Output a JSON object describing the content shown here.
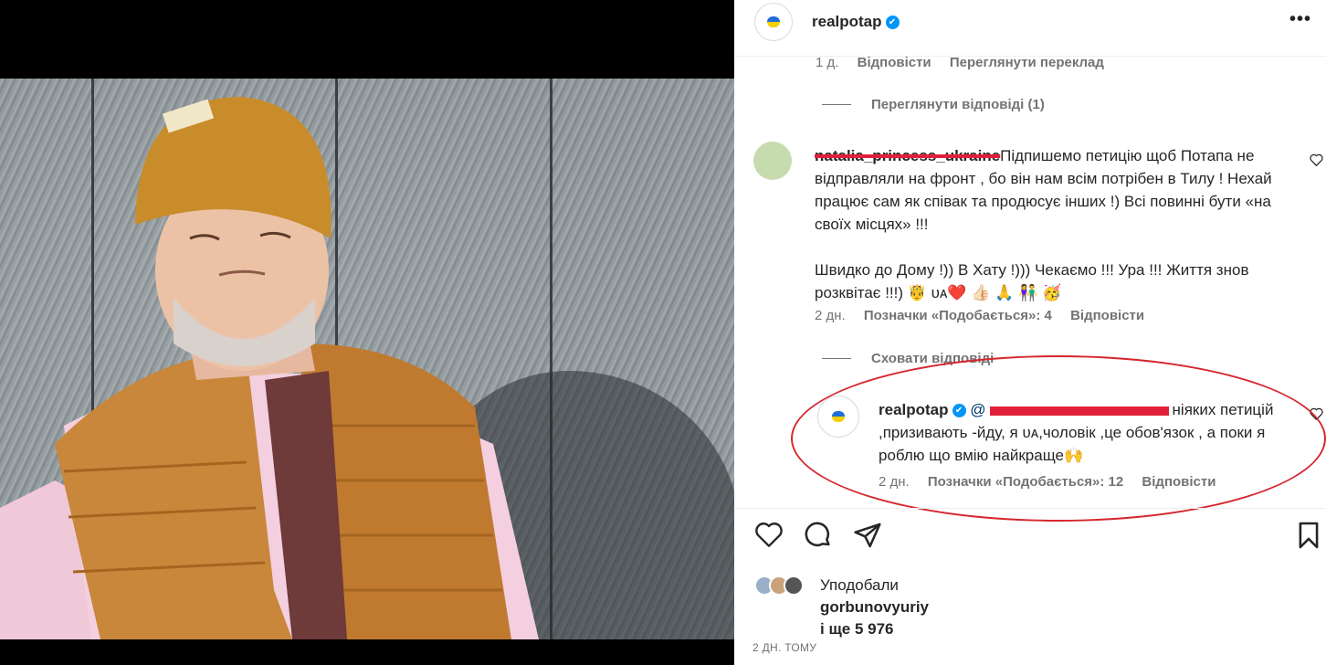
{
  "post": {
    "username": "realpotap",
    "verified_mark": "✔",
    "more_label": "•••",
    "avatar_icon": "heart-flag-icon"
  },
  "comments": [
    {
      "meta": {
        "age": "1 д.",
        "reply": "Відповісти",
        "translate": "Переглянути переклад"
      }
    }
  ],
  "view_replies": "Переглянути відповіді (1)",
  "comment2": {
    "username": "natalia_princess_ukraine",
    "text_line1": "Підпишемо петицію щоб Потапа не відправляли на фронт , бо він нам всім потрібен в Тилу ! Нехай працює сам як співак та продюсує інших !) Всі повинні бути «на своїх місцях» !!!",
    "text_line2": "Швидко до Дому !)) В Хату !))) Чекаємо !!! Ура !!! Життя знов розквітає !!!) 🤴 ᴜᴀ❤️ 👍🏻 🙏 👫 🥳",
    "age": "2 дн.",
    "likes": "Позначки «Подобається»: 4",
    "reply": "Відповісти"
  },
  "hide_replies": "Сховати відповіді",
  "reply": {
    "username": "realpotap",
    "mention": "@",
    "text": "ніяких петицій ,призивають -йду, я ᴜᴀ,чоловік ,це обов'язок , а поки я роблю що вмію найкраще🙌",
    "age": "2 дн.",
    "likes": "Позначки «Подобається»: 12",
    "reply": "Відповісти"
  },
  "actions": {
    "like": "heart-icon",
    "comment": "comment-icon",
    "share": "send-icon",
    "save": "bookmark-icon"
  },
  "likes": {
    "label": "Уподобали",
    "user": "gorbunovyuriy",
    "more": "і ще 5 976"
  },
  "timestamp": "2 ДН. ТОМУ",
  "colors": {
    "verified": "#0095f6",
    "annotation_red": "#d6262d",
    "meta_gray": "#737373"
  }
}
